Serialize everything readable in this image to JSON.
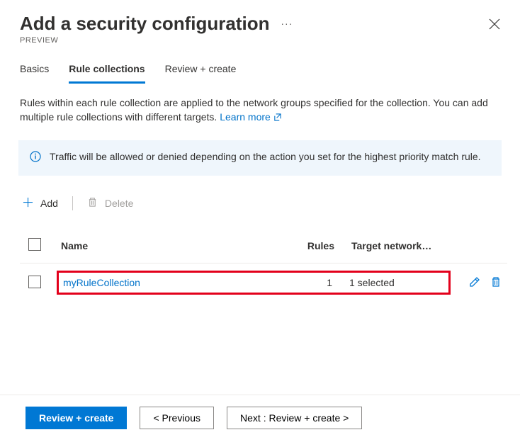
{
  "header": {
    "title": "Add a security configuration",
    "preview": "PREVIEW"
  },
  "tabs": {
    "basics": "Basics",
    "rule_collections": "Rule collections",
    "review_create": "Review + create"
  },
  "description": {
    "text": "Rules within each rule collection are applied to the network groups specified for the collection. You can add multiple rule collections with different targets. ",
    "learn_more": "Learn more"
  },
  "infobox": {
    "text": "Traffic will be allowed or denied depending on the action you set for the highest priority match rule."
  },
  "actions": {
    "add": "Add",
    "delete": "Delete"
  },
  "table": {
    "headers": {
      "name": "Name",
      "rules": "Rules",
      "target": "Target network…"
    },
    "rows": [
      {
        "name": "myRuleCollection",
        "rules": "1",
        "target": "1 selected"
      }
    ]
  },
  "footer": {
    "review_create": "Review + create",
    "previous": "< Previous",
    "next": "Next : Review + create >"
  }
}
